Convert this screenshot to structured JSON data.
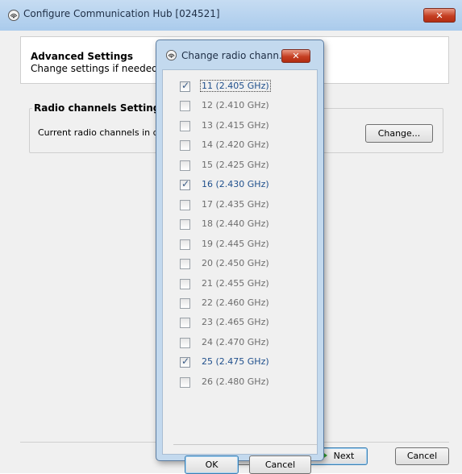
{
  "window": {
    "title": "Configure Communication Hub [024521]",
    "close_label": "✕"
  },
  "header": {
    "title": "Advanced Settings",
    "subtitle": "Change settings if needed"
  },
  "radio_group": {
    "title": "Radio channels Settings",
    "text": "Current radio channels in de",
    "change_label": "Change..."
  },
  "footer": {
    "back_label": "",
    "next_label": "Next",
    "cancel_label": "Cancel"
  },
  "dialog": {
    "title": "Change radio chann...",
    "close_label": "✕",
    "channels": [
      {
        "label": "11 (2.405 GHz)",
        "checked": true
      },
      {
        "label": "12 (2.410 GHz)",
        "checked": false
      },
      {
        "label": "13 (2.415 GHz)",
        "checked": false
      },
      {
        "label": "14 (2.420 GHz)",
        "checked": false
      },
      {
        "label": "15 (2.425 GHz)",
        "checked": false
      },
      {
        "label": "16 (2.430 GHz)",
        "checked": true
      },
      {
        "label": "17 (2.435 GHz)",
        "checked": false
      },
      {
        "label": "18 (2.440 GHz)",
        "checked": false
      },
      {
        "label": "19 (2.445 GHz)",
        "checked": false
      },
      {
        "label": "20 (2.450 GHz)",
        "checked": false
      },
      {
        "label": "21 (2.455 GHz)",
        "checked": false
      },
      {
        "label": "22 (2.460 GHz)",
        "checked": false
      },
      {
        "label": "23 (2.465 GHz)",
        "checked": false
      },
      {
        "label": "24 (2.470 GHz)",
        "checked": false
      },
      {
        "label": "25 (2.475 GHz)",
        "checked": true
      },
      {
        "label": "26 (2.480 GHz)",
        "checked": false
      }
    ],
    "ok_label": "OK",
    "cancel_label": "Cancel"
  },
  "icons": {
    "app": "antenna-icon",
    "checkmark": "checkmark-icon",
    "next": "next-arrow-icon"
  },
  "colors": {
    "checked_label": "#1f4f8c",
    "unchecked_label": "#6d6d6d",
    "close_button": "#c53f22"
  }
}
